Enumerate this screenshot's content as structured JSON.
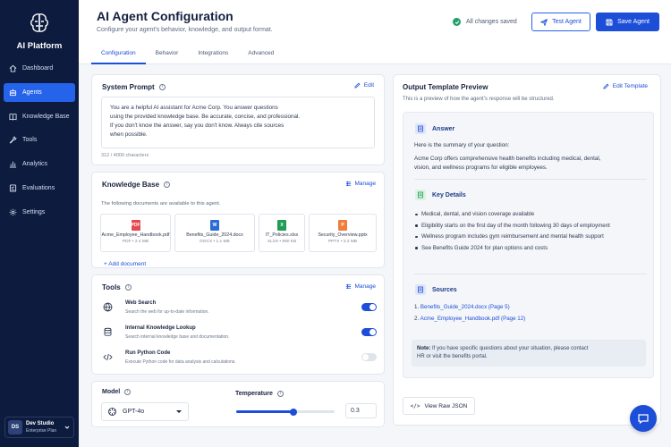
{
  "app": {
    "name": "AI Platform"
  },
  "sidebar": {
    "items": [
      {
        "label": "Dashboard",
        "icon": "home-icon"
      },
      {
        "label": "Agents",
        "icon": "agents-icon",
        "active": true
      },
      {
        "label": "Knowledge Base",
        "icon": "book-icon"
      },
      {
        "label": "Tools",
        "icon": "wrench-icon"
      },
      {
        "label": "Analytics",
        "icon": "chart-icon"
      },
      {
        "label": "Evaluations",
        "icon": "checklist-icon"
      },
      {
        "label": "Settings",
        "icon": "gear-icon"
      }
    ],
    "account": {
      "initials": "DS",
      "name": "Dev Studio",
      "plan": "Enterprise Plan"
    }
  },
  "header": {
    "title": "AI Agent Configuration",
    "subtitle": "Configure your agent's behavior, knowledge, and output format.",
    "status": "All changes saved",
    "test_label": "Test Agent",
    "save_label": "Save Agent",
    "tabs": [
      "Configuration",
      "Behavior",
      "Integrations",
      "Advanced"
    ]
  },
  "system_prompt": {
    "title": "System Prompt",
    "edit_label": "Edit",
    "lines": [
      "You are a helpful AI assistant for Acme Corp. You answer questions",
      "using the provided knowledge base. Be accurate, concise, and professional.",
      "If you don't know the answer, say you don't know. Always cite sources",
      "when possible."
    ],
    "char_count": "312 / 4000 characters"
  },
  "knowledge_base": {
    "title": "Knowledge Base",
    "manage_label": "Manage",
    "description": "The following documents are available to this agent.",
    "documents": [
      {
        "name": "Acme_Employee_Handbook.pdf",
        "meta": "PDF • 2.4 MB",
        "icon": "pdf-icon",
        "badge": "PDF",
        "color": "#e5484d"
      },
      {
        "name": "Benefits_Guide_2024.docx",
        "meta": "DOCX • 1.1 MB",
        "icon": "docx-icon",
        "badge": "W",
        "color": "#2b6cd4"
      },
      {
        "name": "IT_Policies.xlsx",
        "meta": "XLSX • 890 KB",
        "icon": "xlsx-icon",
        "badge": "X",
        "color": "#1f9d55"
      },
      {
        "name": "Security_Overview.pptx",
        "meta": "PPTX • 3.2 MB",
        "icon": "pptx-icon",
        "badge": "P",
        "color": "#ef7d3c"
      }
    ],
    "add_label": "+ Add document"
  },
  "tools": {
    "title": "Tools",
    "manage_label": "Manage",
    "items": [
      {
        "name": "Web Search",
        "desc": "Search the web for up-to-date information.",
        "enabled": true,
        "icon": "globe-icon"
      },
      {
        "name": "Internal Knowledge Lookup",
        "desc": "Search internal knowledge base and documentation.",
        "enabled": true,
        "icon": "database-icon"
      },
      {
        "name": "Run Python Code",
        "desc": "Execute Python code for data analysis and calculations.",
        "enabled": false,
        "icon": "code-icon"
      }
    ]
  },
  "model": {
    "label": "Model",
    "selected": "GPT-4o",
    "temperature_label": "Temperature",
    "temperature": "0.3",
    "temperature_fraction": 0.58
  },
  "preview": {
    "title": "Output Template Preview",
    "edit_label": "Edit Template",
    "description": "This is a preview of how the agent's response will be structured.",
    "answer_title": "Answer",
    "answer_intro": "Here is the summary of your question:",
    "answer_body_1": "Acme Corp offers comprehensive health benefits including medical, dental,",
    "answer_body_2": "vision, and wellness programs for eligible employees.",
    "details_title": "Key Details",
    "details": [
      "Medical, dental, and vision coverage available",
      "Eligibility starts on the first day of the month following 30 days of employment",
      "Wellness program includes gym reimbursement and mental health support",
      "See Benefits Guide 2024 for plan options and costs"
    ],
    "sources_title": "Sources",
    "sources": [
      {
        "num": "1.",
        "text": "Benefits_Guide_2024.docx (Page 5)"
      },
      {
        "num": "2.",
        "text": "Acme_Employee_Handbook.pdf (Page 12)"
      }
    ],
    "note_bold": "Note:",
    "note_1": " If you have specific questions about your situation, please contact",
    "note_2": "HR or visit the benefits portal.",
    "json_label": "View Raw JSON"
  },
  "colors": {
    "accent": "#1d4ed8",
    "sidebar": "#0d1b3e",
    "success": "#22a06b"
  }
}
